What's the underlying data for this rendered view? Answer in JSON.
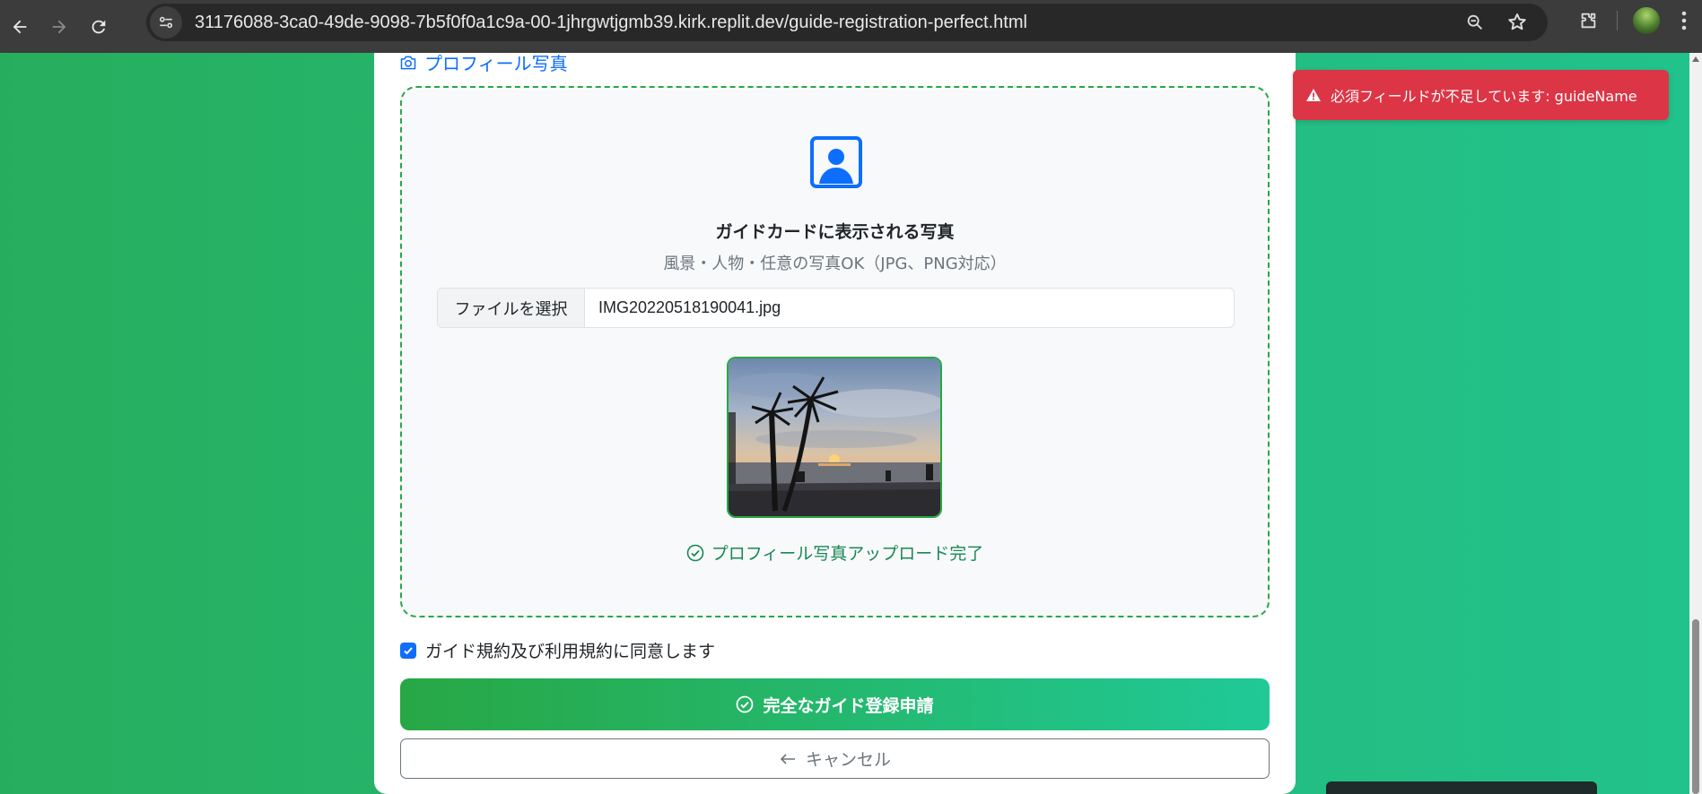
{
  "browser": {
    "url": "31176088-3ca0-49de-9098-7b5f0f0a1c9a-00-1jhrgwtjgmb39.kirk.replit.dev/guide-registration-perfect.html"
  },
  "form": {
    "section_title": "プロフィール写真",
    "upload": {
      "title": "ガイドカードに表示される写真",
      "subtitle": "風景・人物・任意の写真OK（JPG、PNG対応）",
      "file_button": "ファイルを選択",
      "file_name": "IMG20220518190041.jpg",
      "status": "プロフィール写真アップロード完了"
    },
    "agree_label": "ガイド規約及び利用規約に同意します",
    "agree_checked": true,
    "submit_label": "完全なガイド登録申請",
    "cancel_label": "キャンセル"
  },
  "toast": {
    "message": "必須フィールドが不足しています: guideName",
    "color": "#dc3545"
  },
  "colors": {
    "accent": "#0d6efd",
    "success": "#28a745",
    "gradient_end": "#20c997"
  }
}
